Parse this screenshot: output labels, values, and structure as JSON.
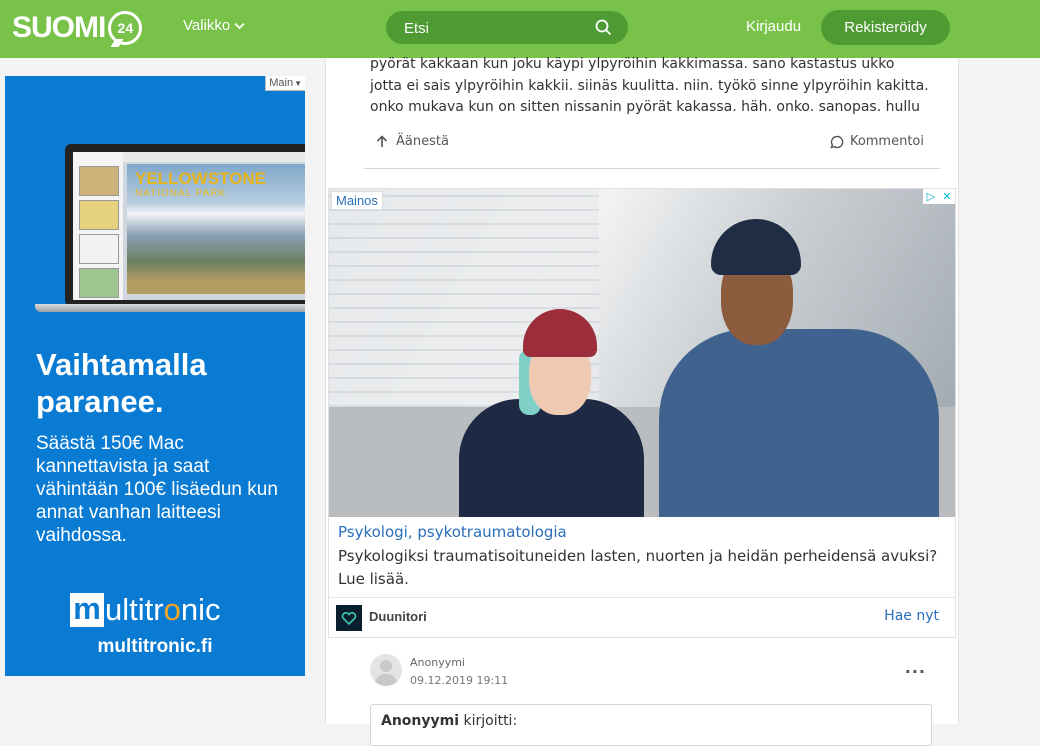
{
  "header": {
    "logo_text": "SUOMI",
    "logo_badge": "24",
    "menu_label": "Valikko",
    "search_placeholder": "Etsi",
    "login_label": "Kirjaudu",
    "register_label": "Rekisteröidy",
    "colors": {
      "bar": "#79c24a",
      "pill": "#4f9b33"
    }
  },
  "left_ad": {
    "tag": "Main",
    "screen_title": "YELLOWSTONE",
    "screen_subtitle": "NATIONAL PARK",
    "headline": "Vaihtamalla paranee.",
    "body": "Säästä 150€ Mac kannettavista ja saat vähintään 100€ lisäedun kun annat vanhan laitteesi vaihdossa.",
    "brand_m": "m",
    "brand_rest_a": "ultitr",
    "brand_o": "o",
    "brand_rest_b": "nic",
    "url": "multitronic.fi",
    "background": "#0a7bd3"
  },
  "post": {
    "text": "pyörät kakkaan kun joku käypi ylpyröihin kakkimassa. sano kastastus ukko jotta ei sais ylpyröihin kakkii. siinäs kuulitta. niin. työkö sinne ylpyröihin kakitta. onko mukava kun on sitten nissanin pyörät kakassa. häh. onko. sanopas. hullu",
    "vote_label": "Äänestä",
    "comment_label": "Kommentoi"
  },
  "native_ad": {
    "tag": "Mainos",
    "title": "Psykologi, psykotraumatologia",
    "description": "Psykologiksi traumatisoituneiden lasten, nuorten ja heidän perheidensä avuksi? Lue lisää.",
    "advertiser": "Duunitori",
    "cta": "Hae nyt"
  },
  "reply": {
    "author": "Anonyymi",
    "date": "09.12.2019 19:11",
    "more": "...",
    "quote_author": "Anonyymi",
    "quote_suffix": " kirjoitti:"
  }
}
